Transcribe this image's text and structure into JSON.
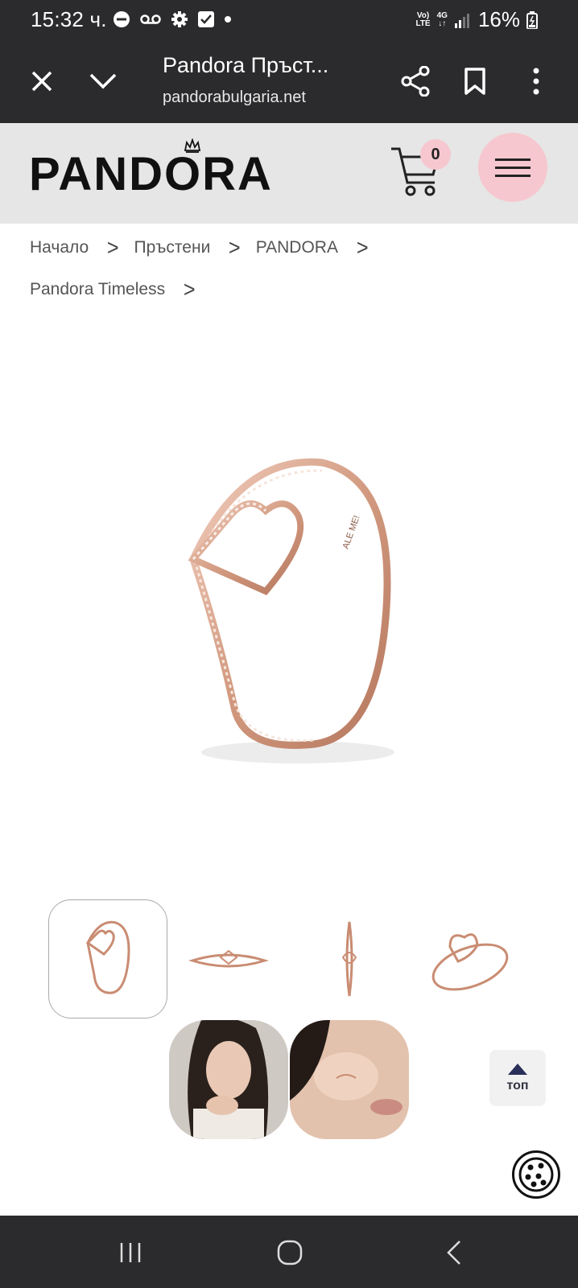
{
  "status_bar": {
    "time": "15:32 ч.",
    "network_top": "Vo)",
    "network_bottom": "LTE",
    "signal_type_top": "4G",
    "signal_type_bottom": "↓↑",
    "battery": "16%"
  },
  "browser": {
    "title": "Pandora Пръст...",
    "url": "pandorabulgaria.net",
    "icons": [
      "close-icon",
      "chevron-down-icon",
      "share-icon",
      "bookmark-icon",
      "more-vert-icon"
    ]
  },
  "header": {
    "logo": "PANDORA",
    "cart_count": "0",
    "accent_color": "#f6c7cf"
  },
  "breadcrumb": {
    "items": [
      "Начало",
      "Пръстени",
      "PANDORA",
      "Pandora Timeless"
    ],
    "separator": ">"
  },
  "product": {
    "ring_engraving": "ALE ME!",
    "metal_color": "#d7a48c"
  },
  "thumbnails": {
    "count": 6,
    "selected_index": 0
  },
  "top_button": {
    "label": "топ"
  }
}
